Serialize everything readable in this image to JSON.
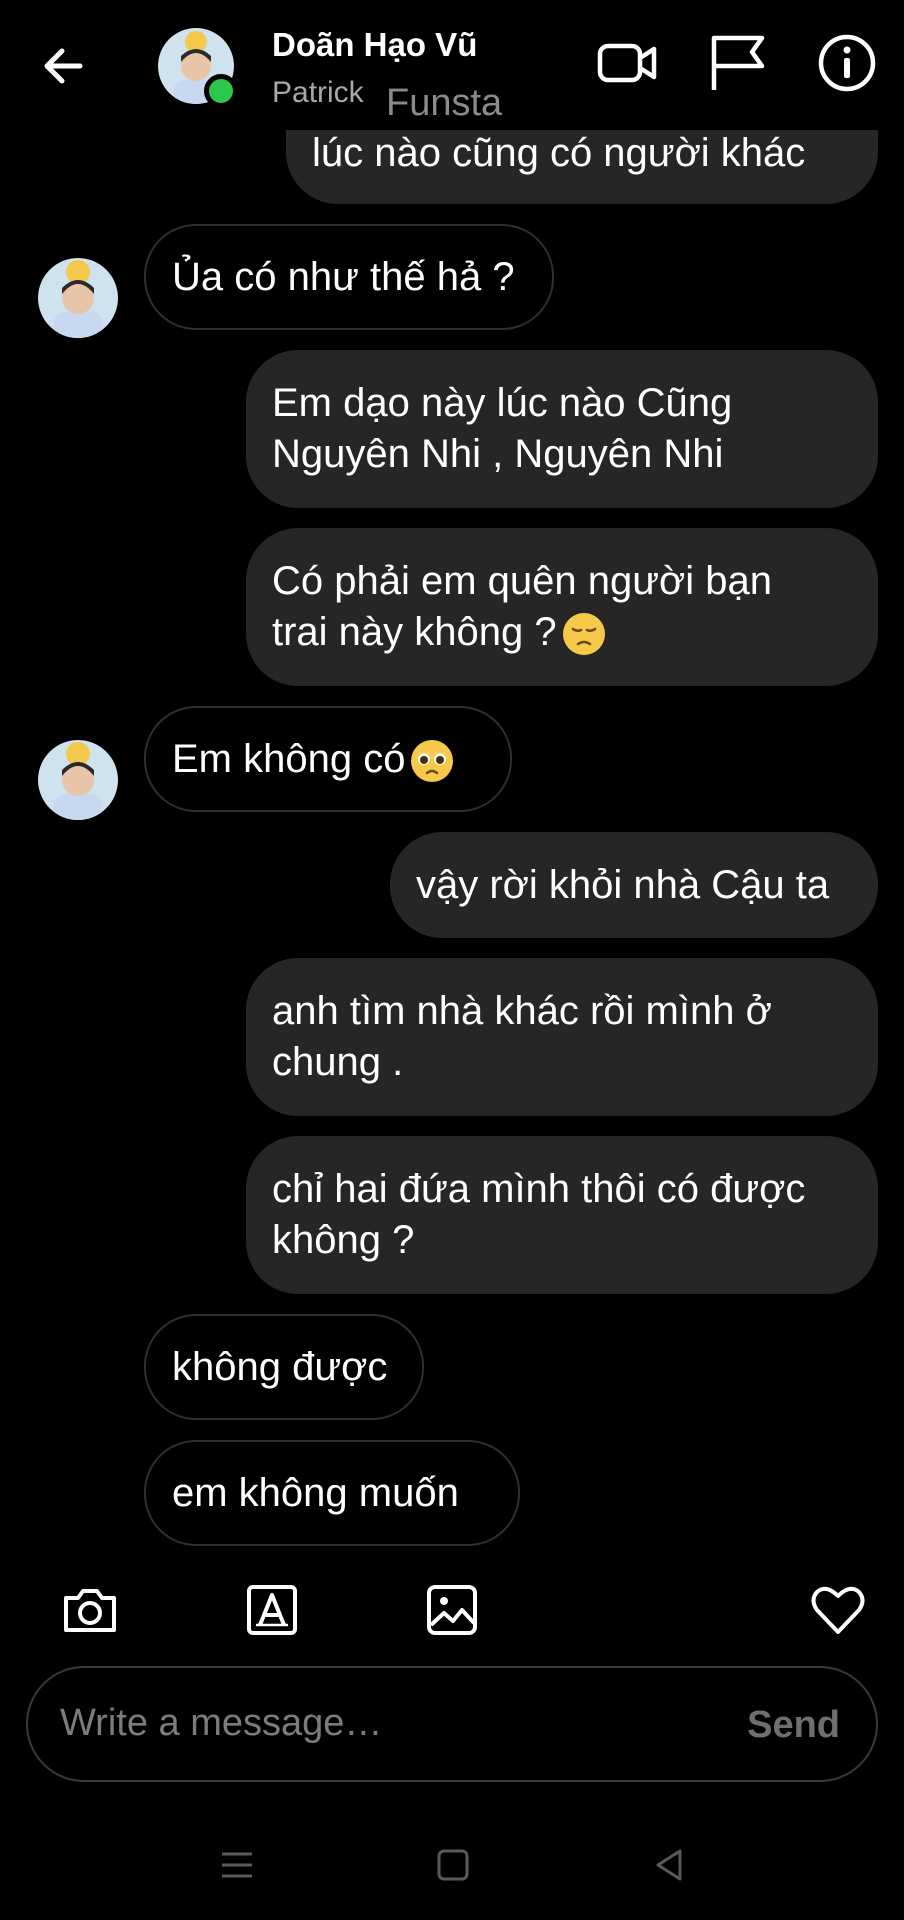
{
  "header": {
    "contact_name": "Doãn Hạo Vũ",
    "contact_sub": "Patrick",
    "overlay_text": "Funsta",
    "icons": [
      "back-arrow-icon",
      "video-call-icon",
      "flag-icon",
      "info-icon"
    ]
  },
  "messages": [
    {
      "direction": "out",
      "text": "lúc nào cũng có người khác"
    },
    {
      "direction": "in",
      "text": "Ủa có như thế hả ?"
    },
    {
      "direction": "out",
      "text": "Em dạo này lúc nào Cũng\nNguyên Nhi , Nguyên Nhi"
    },
    {
      "direction": "out",
      "text": "Có phải em quên người bạn\ntrai này không ?",
      "emoji": "pensive-face"
    },
    {
      "direction": "in",
      "text": "Em không có",
      "emoji": "pleading-face"
    },
    {
      "direction": "out",
      "text": "vậy rời khỏi nhà Cậu ta"
    },
    {
      "direction": "out",
      "text": "anh tìm nhà khác rồi mình ở\nchung ."
    },
    {
      "direction": "out",
      "text": "chỉ hai đứa mình thôi có được\nkhông ?"
    },
    {
      "direction": "in",
      "text": "không được"
    },
    {
      "direction": "in",
      "text": "em không muốn"
    }
  ],
  "composer": {
    "placeholder": "Write a message…",
    "send_label": "Send",
    "tools": [
      "camera-icon",
      "text-format-icon",
      "gallery-icon",
      "heart-icon"
    ]
  },
  "navbar": {
    "icons": [
      "menu-icon",
      "home-square-icon",
      "back-triangle-icon"
    ]
  },
  "colors": {
    "background": "#000000",
    "outgoing_bubble": "#262626",
    "incoming_border": "#2f2f2f",
    "online": "#2bc84b",
    "muted_text": "#a8a8a8"
  }
}
